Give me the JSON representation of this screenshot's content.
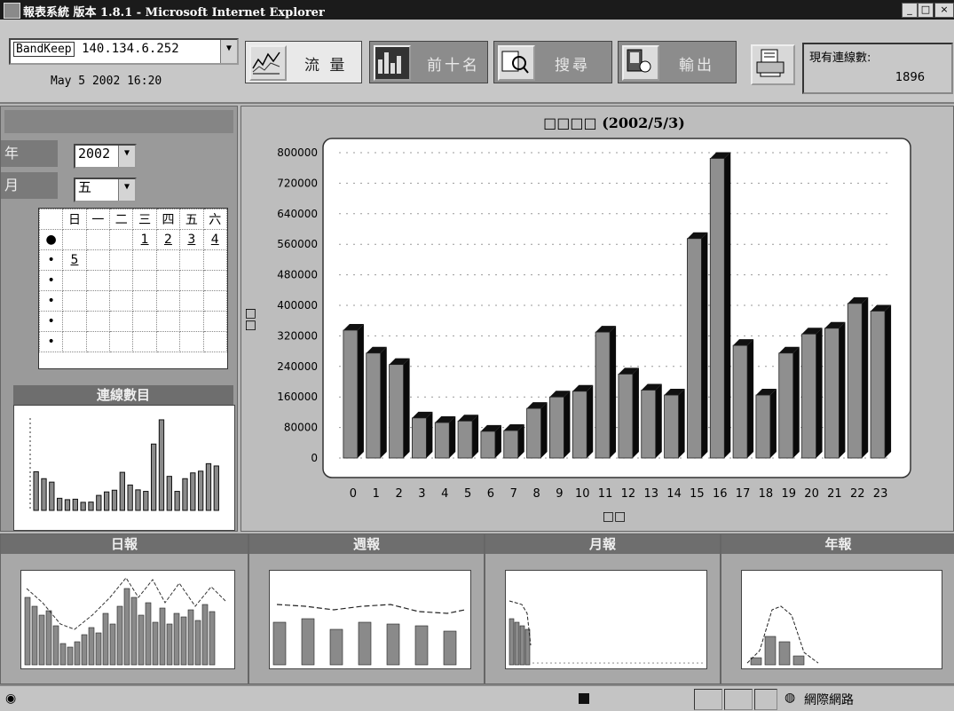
{
  "window": {
    "title": "報表系統 版本 1.8.1 - Microsoft Internet Explorer",
    "min": "_",
    "max": "□",
    "close": "×"
  },
  "toolbar": {
    "device_prefix": "BandKeep",
    "device_ip": "140.134.6.252",
    "datetime": "May 5 2002 16:20",
    "buttons": {
      "traffic": "流 量",
      "top10": "前十名",
      "search": "搜尋",
      "export": "輸出"
    },
    "connections_label": "現有連線數:",
    "connections_value": "1896"
  },
  "left_panel": {
    "year_label": "年",
    "year_value": "2002",
    "month_label": "月",
    "month_value": "五",
    "weekdays": [
      "日",
      "一",
      "二",
      "三",
      "四",
      "五",
      "六"
    ],
    "week1": [
      "",
      "",
      "",
      "1",
      "2",
      "3",
      "4"
    ],
    "week2": [
      "5",
      "",
      "",
      "",
      "",
      "",
      ""
    ],
    "mini_chart_title": "連線數目"
  },
  "chart_data": {
    "type": "bar",
    "title": "□□□□ (2002/5/3)",
    "xlabel": "□□",
    "ylabel": "□□",
    "categories": [
      "0",
      "1",
      "2",
      "3",
      "4",
      "5",
      "6",
      "7",
      "8",
      "9",
      "10",
      "11",
      "12",
      "13",
      "14",
      "15",
      "16",
      "17",
      "18",
      "19",
      "20",
      "21",
      "22",
      "23"
    ],
    "series": [
      {
        "values": [
          335000,
          275000,
          245000,
          105000,
          93000,
          97000,
          70000,
          72000,
          130000,
          160000,
          175000,
          330000,
          220000,
          178000,
          165000,
          575000,
          785000,
          295000,
          165000,
          275000,
          325000,
          340000,
          405000,
          385000
        ]
      }
    ],
    "ylim": [
      0,
      800000
    ],
    "yticks": [
      0,
      80000,
      160000,
      240000,
      320000,
      400000,
      480000,
      560000,
      640000,
      720000,
      800000
    ],
    "grid": true
  },
  "bottom_panels": [
    {
      "title": "日報"
    },
    {
      "title": "週報"
    },
    {
      "title": "月報"
    },
    {
      "title": "年報"
    }
  ],
  "statusbar": {
    "zone": "網際網路"
  }
}
